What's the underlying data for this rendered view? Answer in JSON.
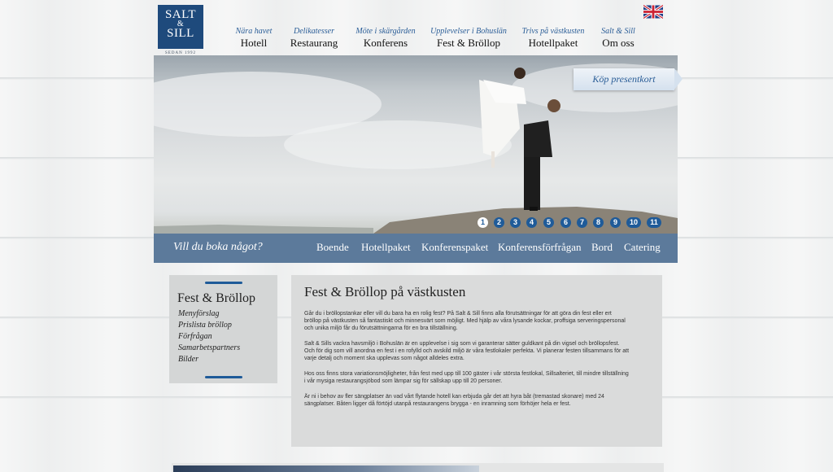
{
  "logo": {
    "line1": "SALT",
    "amp": "&",
    "line2": "SILL",
    "tagline": "SEDAN 1992"
  },
  "flag_icon": "uk-flag-icon",
  "topnav": [
    {
      "sub": "Nära havet",
      "main": "Hotell"
    },
    {
      "sub": "Delikatesser",
      "main": "Restaurang"
    },
    {
      "sub": "Möte i skärgården",
      "main": "Konferens"
    },
    {
      "sub": "Upplevelser i Bohuslän",
      "main": "Fest & Bröllop"
    },
    {
      "sub": "Trivs på västkusten",
      "main": "Hotellpaket"
    },
    {
      "sub": "Salt & Sill",
      "main": "Om oss"
    }
  ],
  "hero": {
    "gift_label": "Köp presentkort",
    "slides": [
      "1",
      "2",
      "3",
      "4",
      "5",
      "6",
      "7",
      "8",
      "9",
      "10",
      "11"
    ],
    "active_slide": "1"
  },
  "bookbar": {
    "title": "Vill du boka något?",
    "links": [
      "Boende",
      "Hotellpaket",
      "Konferenspaket",
      "Konferensförfrågan",
      "Bord",
      "Catering"
    ]
  },
  "sidebar": {
    "title": "Fest & Bröllop",
    "items": [
      "Menyförslag",
      "Prislista bröllop",
      "Förfrågan",
      "Samarbetspartners",
      "Bilder"
    ]
  },
  "content": {
    "title": "Fest & Bröllop på västkusten",
    "paragraphs": [
      "Går du i bröllopstankar eller vill du bara ha en rolig fest? På Salt & Sill finns alla förutsättningar för att göra din fest eller ert bröllop på västkusten så fantastiskt och minnesvärt som möjligt. Med hjälp av våra lysande kockar, proffsiga serveringspersonal och unika miljö får du förutsättningarna för en bra tillställning.",
      "Salt & Sills vackra havsmiljö i Bohuslän är en upplevelse i sig som vi garanterar sätter guldkant på din vigsel och bröllopsfest. Och för dig som vill anordna en fest i en rofylld och avskild miljö är våra festlokaler perfekta. Vi planerar festen tillsammans för att varje detalj och moment ska upplevas som något alldeles extra.",
      "Hos oss finns stora variationsmöjligheter, från fest med upp till 100 gäster i vår största festlokal, Sillsalteriet, till mindre tillställning i vår mysiga restaurangsjöbod som lämpar sig för sällskap upp till 20 personer.",
      "Är ni i behov av fler sängplatser än vad vårt flytande hotell kan erbjuda går det att hyra båt (tremastad skonare) med 24 sängplatser. Båten ligger då förtöjd utanpå restaurangens brygga - en inramning som förhöjer hela er fest."
    ]
  }
}
